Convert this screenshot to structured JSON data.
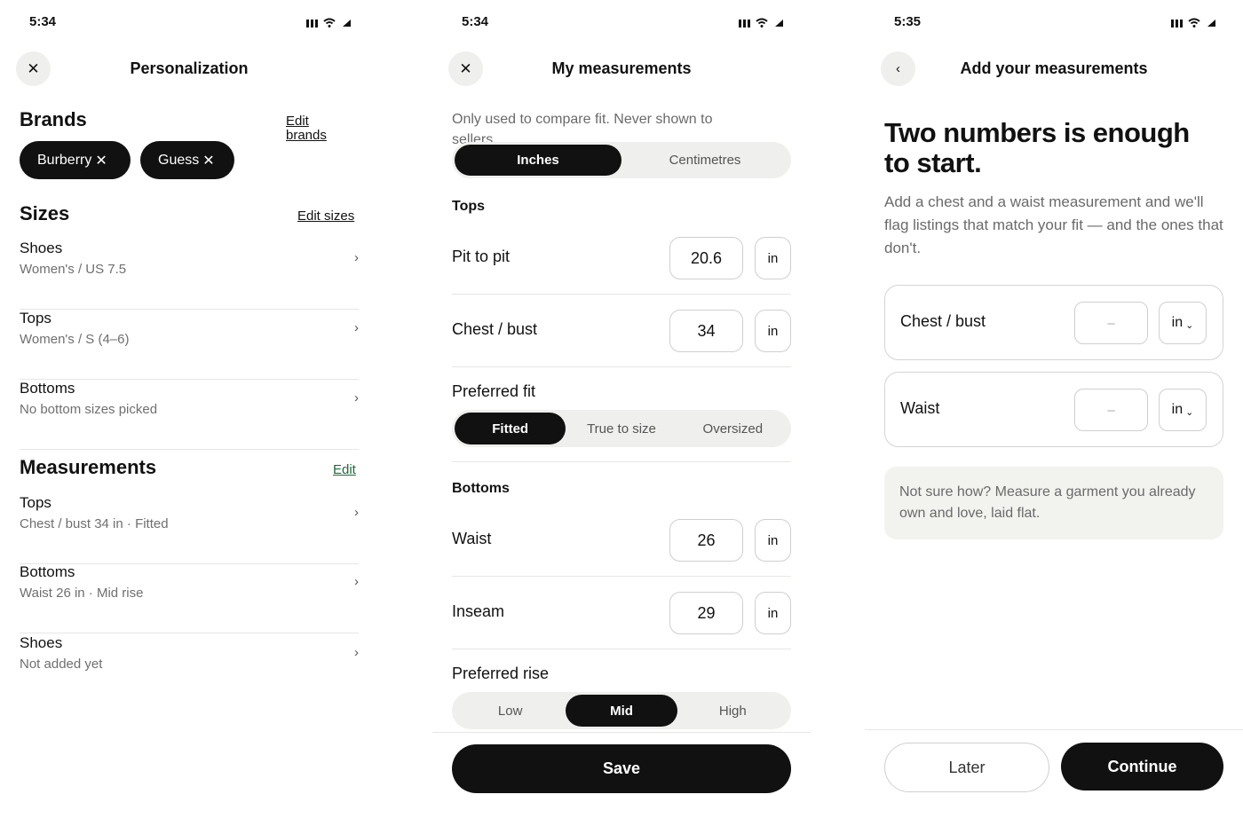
{
  "screens": [
    {
      "time": "5:34",
      "title": "Personalization",
      "close_icon": "close-icon",
      "brands": {
        "heading": "Brands",
        "edit_label_line1": "Edit",
        "edit_label_line2": "brands",
        "chips": [
          "Burberry",
          "Guess"
        ]
      },
      "sizes": {
        "heading": "Sizes",
        "edit_label": "Edit sizes",
        "rows": [
          {
            "title": "Shoes",
            "subtitle": "Women's / US 7.5"
          },
          {
            "title": "Tops",
            "subtitle": "Women's / S (4–6)"
          },
          {
            "title": "Bottoms",
            "subtitle": "No bottom sizes picked"
          }
        ]
      },
      "measurements": {
        "heading": "Measurements",
        "edit_label": "Edit",
        "edit_color": "#1f6b3a",
        "rows": [
          {
            "title": "Tops",
            "subtitle": "Chest / bust 34 in · Fitted"
          },
          {
            "title": "Bottoms",
            "subtitle": "Waist 26 in · Mid rise"
          },
          {
            "title": "Shoes",
            "subtitle": "Not added yet"
          }
        ]
      }
    },
    {
      "time": "5:34",
      "title": "My measurements",
      "note": "Only used to compare fit. Never shown to sellers.",
      "units": {
        "options": [
          "Inches",
          "Centimetres"
        ],
        "selected": "Inches"
      },
      "tops": {
        "heading": "Tops",
        "rows": [
          {
            "label": "Pit to pit",
            "value": "20.6",
            "unit": "in"
          },
          {
            "label": "Chest / bust",
            "value": "34",
            "unit": "in"
          }
        ],
        "fit_label": "Preferred fit",
        "fit_options": [
          "Fitted",
          "True to size",
          "Oversized"
        ],
        "fit_selected": "Fitted"
      },
      "bottoms": {
        "heading": "Bottoms",
        "rows": [
          {
            "label": "Waist",
            "value": "26",
            "unit": "in"
          },
          {
            "label": "Inseam",
            "value": "29",
            "unit": "in"
          }
        ],
        "rise_label": "Preferred rise",
        "rise_options": [
          "Low",
          "Mid",
          "High"
        ],
        "rise_selected": "Mid"
      },
      "save_label": "Save"
    },
    {
      "time": "5:35",
      "title": "Add your measurements",
      "back_icon": "chevron-left-icon",
      "hero": "Two numbers is enough to start.",
      "paragraph": "Add a chest and a waist measurement and we'll flag listings that match your fit — and the ones that don't.",
      "fields": [
        {
          "label": "Chest / bust",
          "placeholder": "–",
          "unit": "in"
        },
        {
          "label": "Waist",
          "placeholder": "–",
          "unit": "in"
        }
      ],
      "hint": "Not sure how? Measure a garment you already own and love, laid flat.",
      "later_label": "Later",
      "continue_label": "Continue"
    }
  ]
}
